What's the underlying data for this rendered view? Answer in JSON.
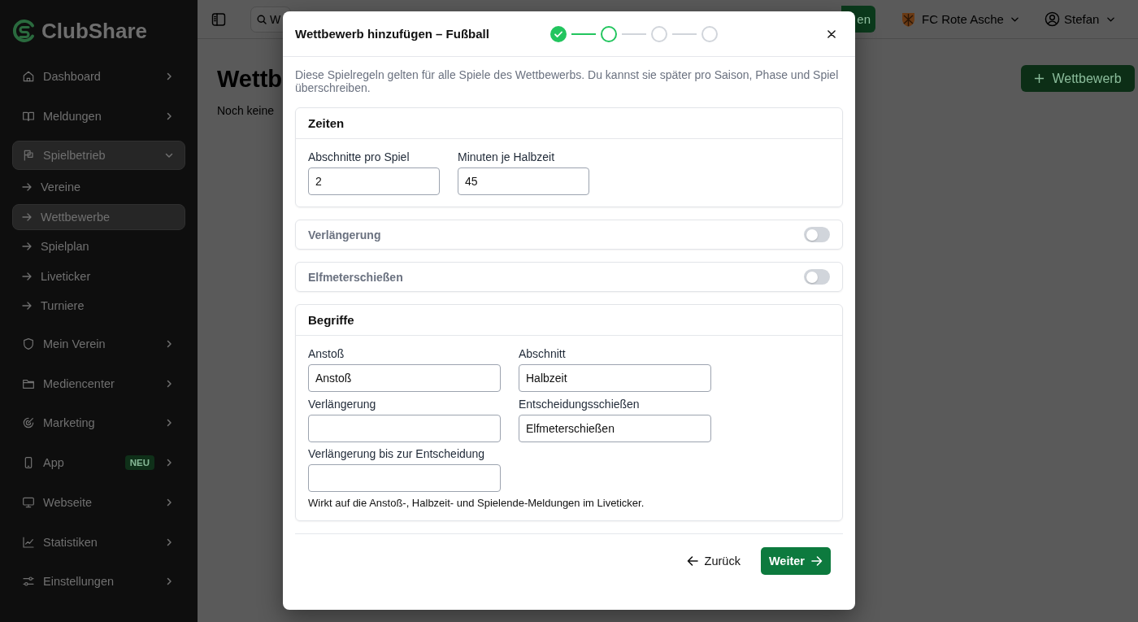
{
  "sidebar": {
    "logo": "ClubShare",
    "items": [
      {
        "label": "Dashboard",
        "selected": false,
        "expanded": false
      },
      {
        "label": "Meldungen",
        "selected": false,
        "expanded": false
      },
      {
        "label": "Spielbetrieb",
        "selected": true,
        "expanded": true,
        "children": [
          {
            "label": "Vereine",
            "selected": false
          },
          {
            "label": "Wettbewerbe",
            "selected": true
          },
          {
            "label": "Spielplan",
            "selected": false
          },
          {
            "label": "Liveticker",
            "selected": false
          },
          {
            "label": "Turniere",
            "selected": false
          }
        ]
      },
      {
        "label": "Mein Verein",
        "selected": false,
        "expanded": false
      },
      {
        "label": "Mediencenter",
        "selected": false,
        "expanded": false
      },
      {
        "label": "Marketing",
        "selected": false,
        "expanded": false
      },
      {
        "label": "App",
        "selected": false,
        "expanded": false,
        "badge": "NEU"
      },
      {
        "label": "Webseite",
        "selected": false,
        "expanded": false
      },
      {
        "label": "Statistiken",
        "selected": false,
        "expanded": false
      },
      {
        "label": "Einstellungen",
        "selected": false,
        "expanded": false
      }
    ]
  },
  "topbar": {
    "search": {
      "placeholder": "W"
    },
    "action_button": "en",
    "club": "FC Rote Asche",
    "user": "Stefan"
  },
  "main": {
    "title": "Wettb",
    "subtitle": "Noch keine",
    "add_button": "Wettbewerb"
  },
  "modal": {
    "title": "Wettbewerb hinzufügen – Fußball",
    "steps": [
      {
        "done": true,
        "selected": false
      },
      {
        "done": false,
        "selected": true
      },
      {
        "done": false,
        "selected": false
      },
      {
        "done": false,
        "selected": false
      }
    ],
    "intro": "Diese Spielregeln gelten für alle Spiele des Wettbewerbs. Du kannst sie später pro Saison, Phase und Spiel überschreiben.",
    "sections": [
      {
        "kind": "fields",
        "title": "Zeiten",
        "fields": [
          {
            "label": "Abschnitte pro Spiel",
            "value": "2"
          },
          {
            "label": "Minuten je Halbzeit",
            "value": "45"
          }
        ]
      },
      {
        "kind": "toggle",
        "title": "Verlängerung",
        "on": false
      },
      {
        "kind": "toggle",
        "title": "Elfmeterschießen",
        "on": false
      },
      {
        "kind": "grid",
        "title": "Begriffe",
        "fields": [
          {
            "label": "Anstoß",
            "value": "Anstoß"
          },
          {
            "label": "Abschnitt",
            "value": "Halbzeit"
          },
          {
            "label": "Verlängerung"
          },
          {
            "label": "Entscheidungsschießen",
            "value": "Elfmeterschießen"
          },
          {
            "label": "Verlängerung bis zur Entscheidung"
          }
        ],
        "note": "Wirkt auf die Anstoß-, Halbzeit- und Spielende-Meldungen im Liveticker."
      }
    ],
    "back_button": "Zurück",
    "next_button": "Weiter"
  }
}
